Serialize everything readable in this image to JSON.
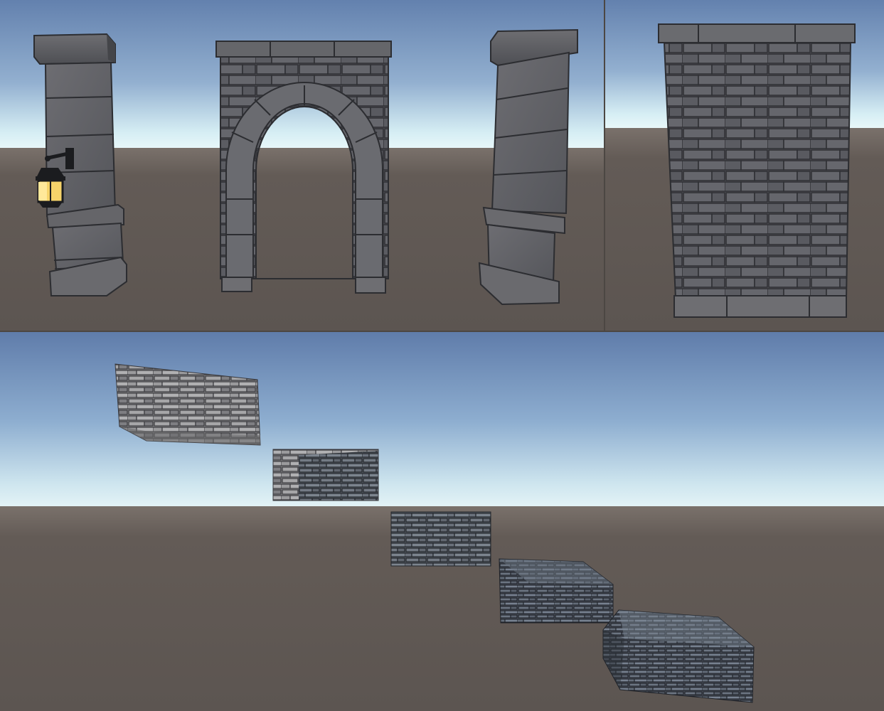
{
  "scene": {
    "panels": [
      "stone-kit-models",
      "textured-stone-blocks"
    ],
    "colors": {
      "sky_top": "#6381ae",
      "sky_mid": "#a9c3da",
      "horizon": "#e4f4f8",
      "ground": "#5f5853",
      "stone_light": "#737377",
      "stone_mid": "#5e5e63",
      "stone_dark": "#3f4045",
      "mortar": "#2b2c30",
      "lantern_glow": "#f6d36a"
    },
    "objects_top": [
      "pillar-with-lantern",
      "stone-archway",
      "tilted-pillar",
      "brick-wall-panel"
    ],
    "objects_bottom": [
      "block-1",
      "block-2",
      "block-3",
      "block-4",
      "block-5"
    ]
  }
}
